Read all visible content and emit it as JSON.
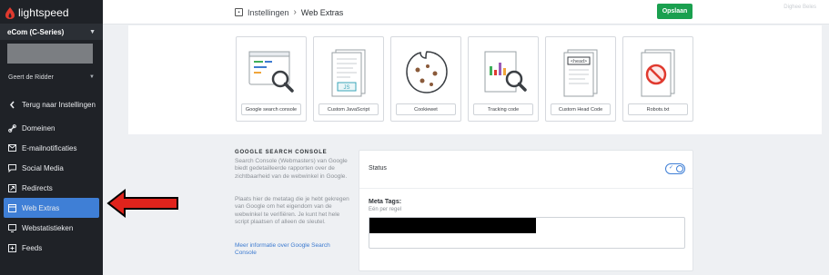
{
  "app": {
    "logo_text": "lightspeed",
    "shop_selector": "eCom (C-Series)",
    "user_name": "Geert de Ridder",
    "top_right_text": "Dighee Beles"
  },
  "sidebar": {
    "items": [
      {
        "label": "Terug naar Instellingen",
        "icon": "chevron-left-icon"
      },
      {
        "label": "Domeinen",
        "icon": "link-icon"
      },
      {
        "label": "E-mailnotificaties",
        "icon": "mail-icon"
      },
      {
        "label": "Social Media",
        "icon": "chat-icon"
      },
      {
        "label": "Redirects",
        "icon": "redirect-icon"
      },
      {
        "label": "Web Extras",
        "icon": "window-icon",
        "active": true
      },
      {
        "label": "Webstatistieken",
        "icon": "monitor-icon"
      },
      {
        "label": "Feeds",
        "icon": "feed-icon"
      }
    ]
  },
  "header": {
    "breadcrumb_root": "Instellingen",
    "breadcrumb_current": "Web Extras",
    "save_label": "Opslaan"
  },
  "extras": {
    "cards": [
      {
        "label": "Google search console",
        "icon": "google-search-console-icon"
      },
      {
        "label": "Custom JavaScript",
        "icon": "javascript-file-icon"
      },
      {
        "label": "Cookiewet",
        "icon": "cookie-icon"
      },
      {
        "label": "Tracking code",
        "icon": "tracking-chart-icon"
      },
      {
        "label": "Custom Head Code",
        "icon": "head-code-icon"
      },
      {
        "label": "Robots.txt",
        "icon": "robots-blocked-icon"
      }
    ]
  },
  "gsc": {
    "title": "GOOGLE SEARCH CONSOLE",
    "description": "Search Console (Webmasters) van Google biedt gedetailleerde rapporten over de zichtbaarheid van de webwinkel in Google.",
    "instructions": "Plaats hier de metatag die je hebt gekregen van Google om het eigendom van de webwinkel te verifiëren. Je kunt het hele script plaatsen of alleen de sleutel.",
    "link_text": "Meer informatie over Google Search Console",
    "status_label": "Status",
    "status_enabled": true,
    "meta_label": "Meta Tags:",
    "meta_sub": "Eén per regel",
    "meta_value": ""
  },
  "colors": {
    "sidebar_bg": "#1f2227",
    "active_blue": "#3f7fd6",
    "save_green": "#1aa04f",
    "link_blue": "#3d7bd0",
    "annotation_red": "#e0231c"
  }
}
